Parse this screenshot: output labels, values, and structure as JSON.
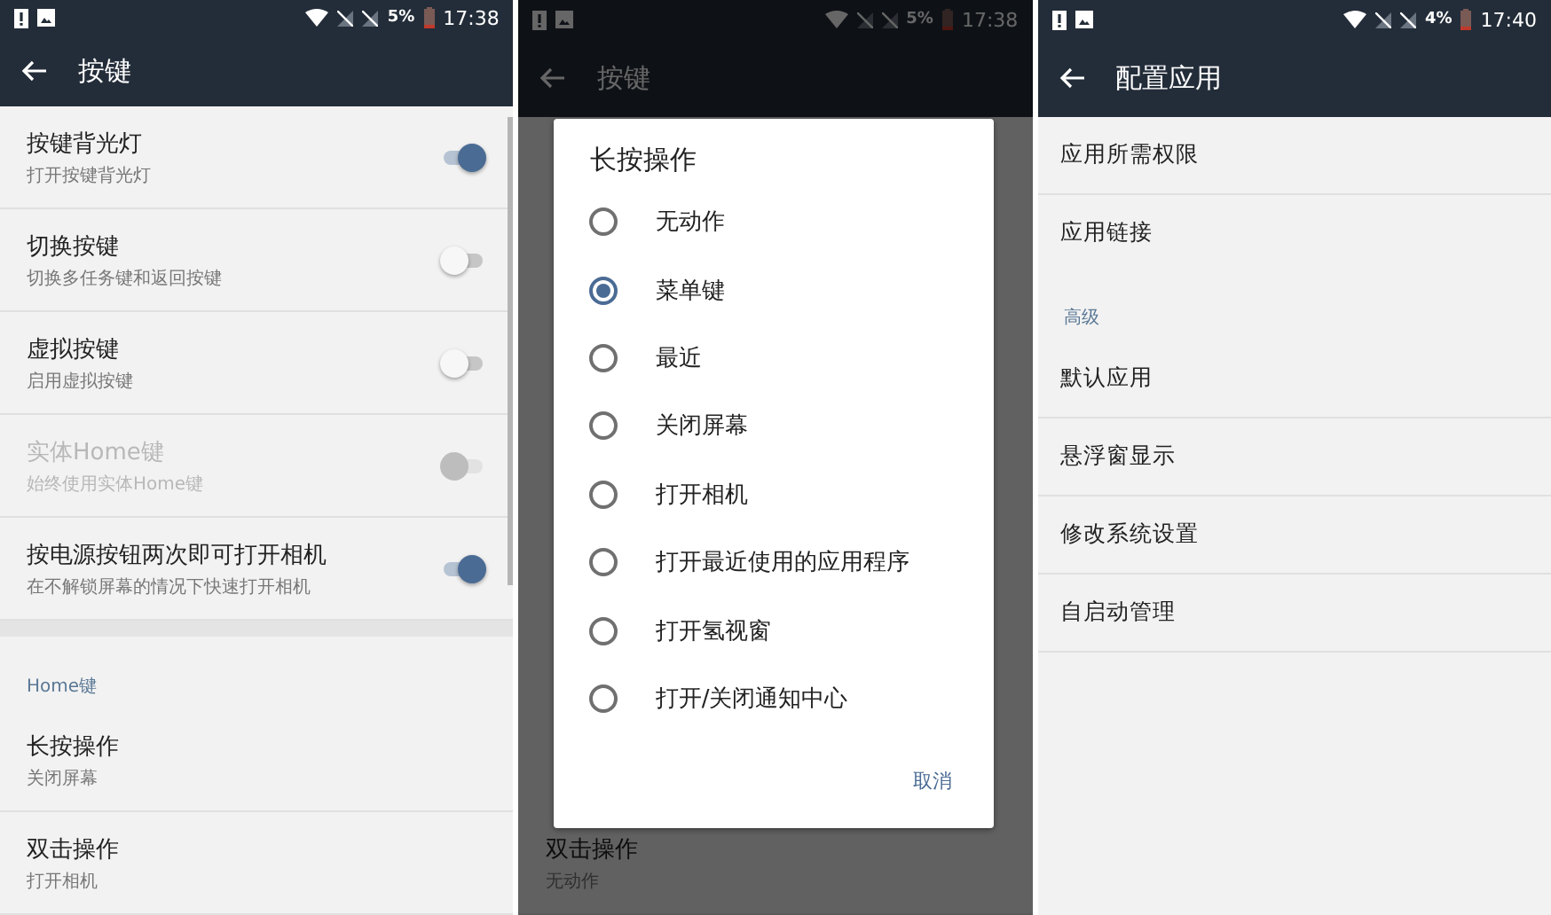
{
  "screens": [
    {
      "status_bar": {
        "battery": "5%",
        "time": "17:38"
      },
      "toolbar": {
        "title": "按键"
      },
      "scrollbar": true,
      "items": [
        {
          "kind": "switch",
          "title": "按键背光灯",
          "subtitle": "打开按键背光灯",
          "on": true,
          "disabled": false
        },
        {
          "kind": "switch",
          "title": "切换按键",
          "subtitle": "切换多任务键和返回按键",
          "on": false,
          "disabled": false
        },
        {
          "kind": "switch",
          "title": "虚拟按键",
          "subtitle": "启用虚拟按键",
          "on": false,
          "disabled": false
        },
        {
          "kind": "switch",
          "title": "实体Home键",
          "subtitle": "始终使用实体Home键",
          "on": false,
          "disabled": true
        },
        {
          "kind": "switch",
          "title": "按电源按钮两次即可打开相机",
          "subtitle": "在不解锁屏幕的情况下快速打开相机",
          "on": true,
          "disabled": false
        },
        {
          "kind": "header",
          "title": "Home键",
          "separated": true
        },
        {
          "kind": "item",
          "title": "长按操作",
          "subtitle": "关闭屏幕"
        },
        {
          "kind": "item",
          "title": "双击操作",
          "subtitle": "打开相机"
        }
      ]
    },
    {
      "status_bar": {
        "battery": "5%",
        "time": "17:38"
      },
      "toolbar": {
        "title": "按键"
      },
      "items": [
        {
          "kind": "item",
          "title": "双击操作",
          "subtitle": "无动作"
        }
      ],
      "dialog": {
        "title": "长按操作",
        "options": [
          {
            "label": "无动作",
            "selected": false
          },
          {
            "label": "菜单键",
            "selected": true
          },
          {
            "label": "最近",
            "selected": false
          },
          {
            "label": "关闭屏幕",
            "selected": false
          },
          {
            "label": "打开相机",
            "selected": false
          },
          {
            "label": "打开最近使用的应用程序",
            "selected": false
          },
          {
            "label": "打开氢视窗",
            "selected": false
          },
          {
            "label": "打开/关闭通知中心",
            "selected": false
          }
        ],
        "buttons": [
          "取消"
        ]
      }
    },
    {
      "status_bar": {
        "battery": "4%",
        "time": "17:40"
      },
      "toolbar": {
        "title": "配置应用"
      },
      "items": [
        {
          "kind": "plain",
          "title": "应用所需权限",
          "divider": true
        },
        {
          "kind": "plain",
          "title": "应用链接",
          "divider": false
        },
        {
          "kind": "header",
          "title": "高级"
        },
        {
          "kind": "plain",
          "title": "默认应用",
          "divider": true
        },
        {
          "kind": "plain",
          "title": "悬浮窗显示",
          "divider": true
        },
        {
          "kind": "plain",
          "title": "修改系统设置",
          "divider": true
        },
        {
          "kind": "plain",
          "title": "自启动管理",
          "divider": true
        }
      ]
    }
  ]
}
